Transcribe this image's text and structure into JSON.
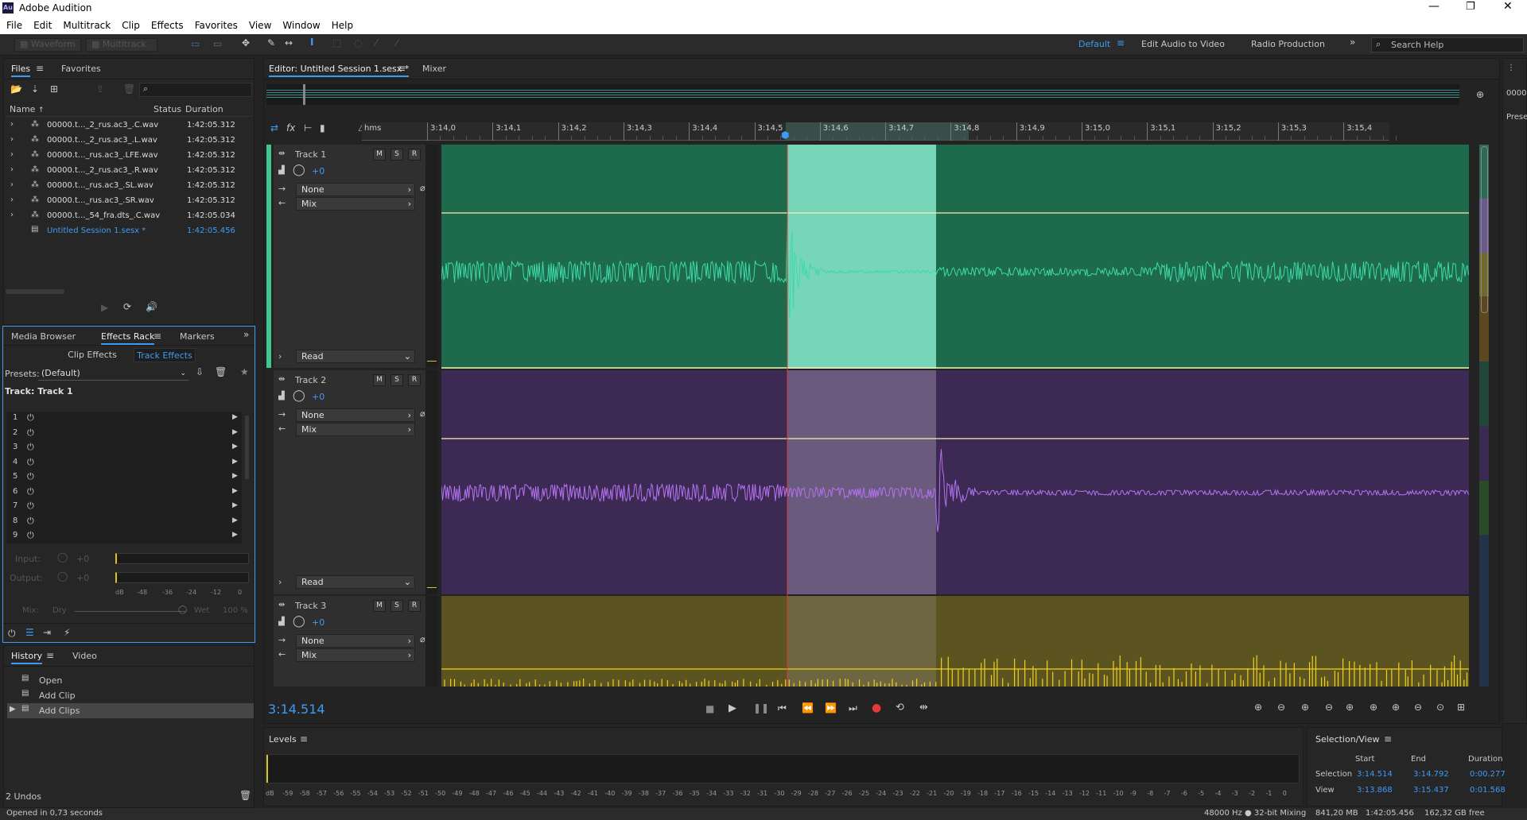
{
  "window": {
    "app_icon": "Au",
    "title": "Adobe Audition"
  },
  "menu": [
    "File",
    "Edit",
    "Multitrack",
    "Clip",
    "Effects",
    "Favorites",
    "View",
    "Window",
    "Help"
  ],
  "toolbar": {
    "waveform": "Waveform",
    "multitrack": "Multitrack",
    "workspaces": [
      "Default",
      "Edit Audio to Video",
      "Radio Production"
    ],
    "search_placeholder": "Search Help"
  },
  "files_panel": {
    "tabs": [
      "Files",
      "Favorites"
    ],
    "columns": [
      "Name",
      "Status",
      "Duration"
    ],
    "items": [
      {
        "name": "00000.t..._2_rus.ac3_.C.wav",
        "duration": "1:42:05.312"
      },
      {
        "name": "00000.t..._2_rus.ac3_.L.wav",
        "duration": "1:42:05.312"
      },
      {
        "name": "00000.t..._rus.ac3_.LFE.wav",
        "duration": "1:42:05.312"
      },
      {
        "name": "00000.t..._2_rus.ac3_.R.wav",
        "duration": "1:42:05.312"
      },
      {
        "name": "00000.t..._rus.ac3_.SL.wav",
        "duration": "1:42:05.312"
      },
      {
        "name": "00000.t..._rus.ac3_.SR.wav",
        "duration": "1:42:05.312"
      },
      {
        "name": "00000.t..._54_fra.dts_.C.wav",
        "duration": "1:42:05.034"
      }
    ],
    "session": {
      "name": "Untitled Session 1.sesx *",
      "duration": "1:42:05.456"
    }
  },
  "effects_panel": {
    "tabs": [
      "Media Browser",
      "Effects Rack",
      "Markers"
    ],
    "subtabs": [
      "Clip Effects",
      "Track Effects"
    ],
    "presets_label": "Presets:",
    "preset_value": "(Default)",
    "track_label": "Track: Track 1",
    "slots": [
      "1",
      "2",
      "3",
      "4",
      "5",
      "6",
      "7",
      "8",
      "9"
    ],
    "input_label": "Input:",
    "input_val": "+0",
    "output_label": "Output:",
    "output_val": "+0",
    "db_ticks": [
      "dB",
      "-48",
      "-36",
      "-24",
      "-12",
      "0"
    ],
    "mix_label": "Mix:",
    "dry": "Dry",
    "wet": "Wet",
    "wet_pct": "100 %"
  },
  "history_panel": {
    "tabs": [
      "History",
      "Video"
    ],
    "items": [
      "Open",
      "Add Clip",
      "Add Clips"
    ],
    "undos": "2 Undos"
  },
  "status_left": "Opened in 0,73 seconds",
  "editor": {
    "tab": "Editor: Untitled Session 1.sesx *",
    "mixer_tab": "Mixer",
    "ruler_unit": "hms",
    "ruler_labels": [
      "3:14,0",
      "3:14,1",
      "3:14,2",
      "3:14,3",
      "3:14,4",
      "3:14,5",
      "3:14,6",
      "3:14,7",
      "3:14,8",
      "3:14,9",
      "3:15,0",
      "3:15,1",
      "3:15,2",
      "3:15,3",
      "3:15,4"
    ],
    "tracks": [
      {
        "name": "Track 1",
        "vol": "+0",
        "input": "None",
        "output": "Mix",
        "automation": "Read",
        "color": "#1d6a4c",
        "wave": "#3fd9a8"
      },
      {
        "name": "Track 2",
        "vol": "+0",
        "input": "None",
        "output": "Mix",
        "automation": "Read",
        "color": "#3c2a54",
        "wave": "#b572f0"
      },
      {
        "name": "Track 3",
        "vol": "+0",
        "input": "None",
        "output": "Mix",
        "automation": "",
        "color": "#5b5320",
        "wave": "#f0d21c"
      }
    ],
    "btn_m": "M",
    "btn_s": "S",
    "btn_r": "R",
    "current_time": "3:14.514"
  },
  "levels_panel": {
    "title": "Levels",
    "scale": [
      "dB",
      "-59",
      "-58",
      "-57",
      "-56",
      "-55",
      "-54",
      "-53",
      "-52",
      "-51",
      "-50",
      "-49",
      "-48",
      "-47",
      "-46",
      "-45",
      "-44",
      "-43",
      "-42",
      "-41",
      "-40",
      "-39",
      "-38",
      "-37",
      "-36",
      "-35",
      "-34",
      "-33",
      "-32",
      "-31",
      "-30",
      "-29",
      "-28",
      "-27",
      "-26",
      "-25",
      "-24",
      "-23",
      "-22",
      "-21",
      "-20",
      "-19",
      "-18",
      "-17",
      "-16",
      "-15",
      "-14",
      "-13",
      "-12",
      "-11",
      "-10",
      "-9",
      "-8",
      "-7",
      "-6",
      "-5",
      "-4",
      "-3",
      "-2",
      "-1",
      "0"
    ]
  },
  "selection_view": {
    "title": "Selection/View",
    "cols": [
      "Start",
      "End",
      "Duration"
    ],
    "rows": [
      {
        "label": "Selection",
        "start": "3:14.514",
        "end": "3:14.792",
        "duration": "0:00.277"
      },
      {
        "label": "View",
        "start": "3:13.868",
        "end": "3:15.437",
        "duration": "0:01.568"
      }
    ]
  },
  "status_right": [
    "48000 Hz ● 32-bit Mixing",
    "841,20 MB",
    "1:42:05.456",
    "162,32 GB free"
  ],
  "right_edge": {
    "top": "00000",
    "pres": "Prese"
  },
  "colors": {
    "accent": "#3e9bf5",
    "selection": "#7ad6bc",
    "playhead": "#e23a3a"
  }
}
